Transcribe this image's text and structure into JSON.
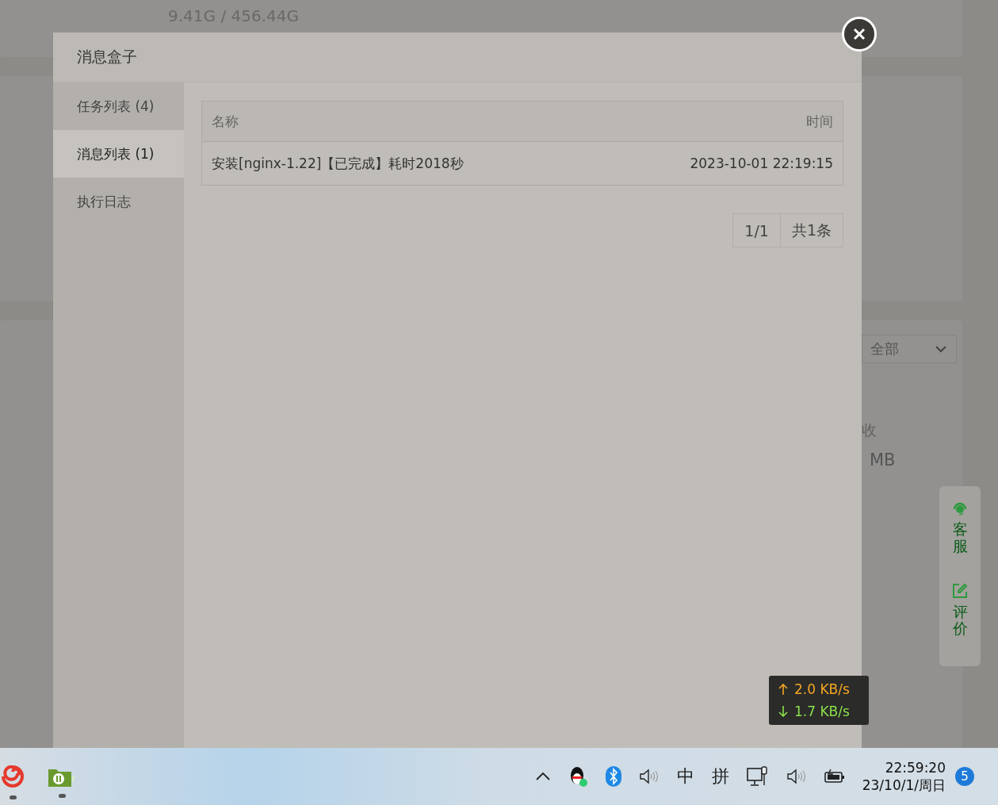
{
  "background": {
    "disk_usage": "9.41G / 456.44G",
    "filter_select": {
      "value": "全部"
    },
    "label_fragment": "收",
    "value_fragment": "MB"
  },
  "side_tools": [
    {
      "label": "客服",
      "kind": "support"
    },
    {
      "label": "评价",
      "kind": "review"
    }
  ],
  "dialog": {
    "title": "消息盒子",
    "tabs": [
      {
        "label": "任务列表 (4)",
        "selected": false
      },
      {
        "label": "消息列表 (1)",
        "selected": true
      },
      {
        "label": "执行日志",
        "selected": false
      }
    ],
    "table": {
      "columns": [
        "名称",
        "时间"
      ],
      "rows": [
        [
          "安装[nginx-1.22]【已完成】耗时2018秒",
          "2023-10-01 22:19:15"
        ]
      ]
    },
    "pagination": {
      "page": "1/1",
      "total": "共1条"
    }
  },
  "net_speed": {
    "upload": "2.0 KB/s",
    "download": "1.7 KB/s"
  },
  "taskbar": {
    "ime_mode": "中",
    "ime_layout": "拼",
    "time": "22:59:20",
    "date": "23/10/1/周日",
    "notifications": "5"
  }
}
